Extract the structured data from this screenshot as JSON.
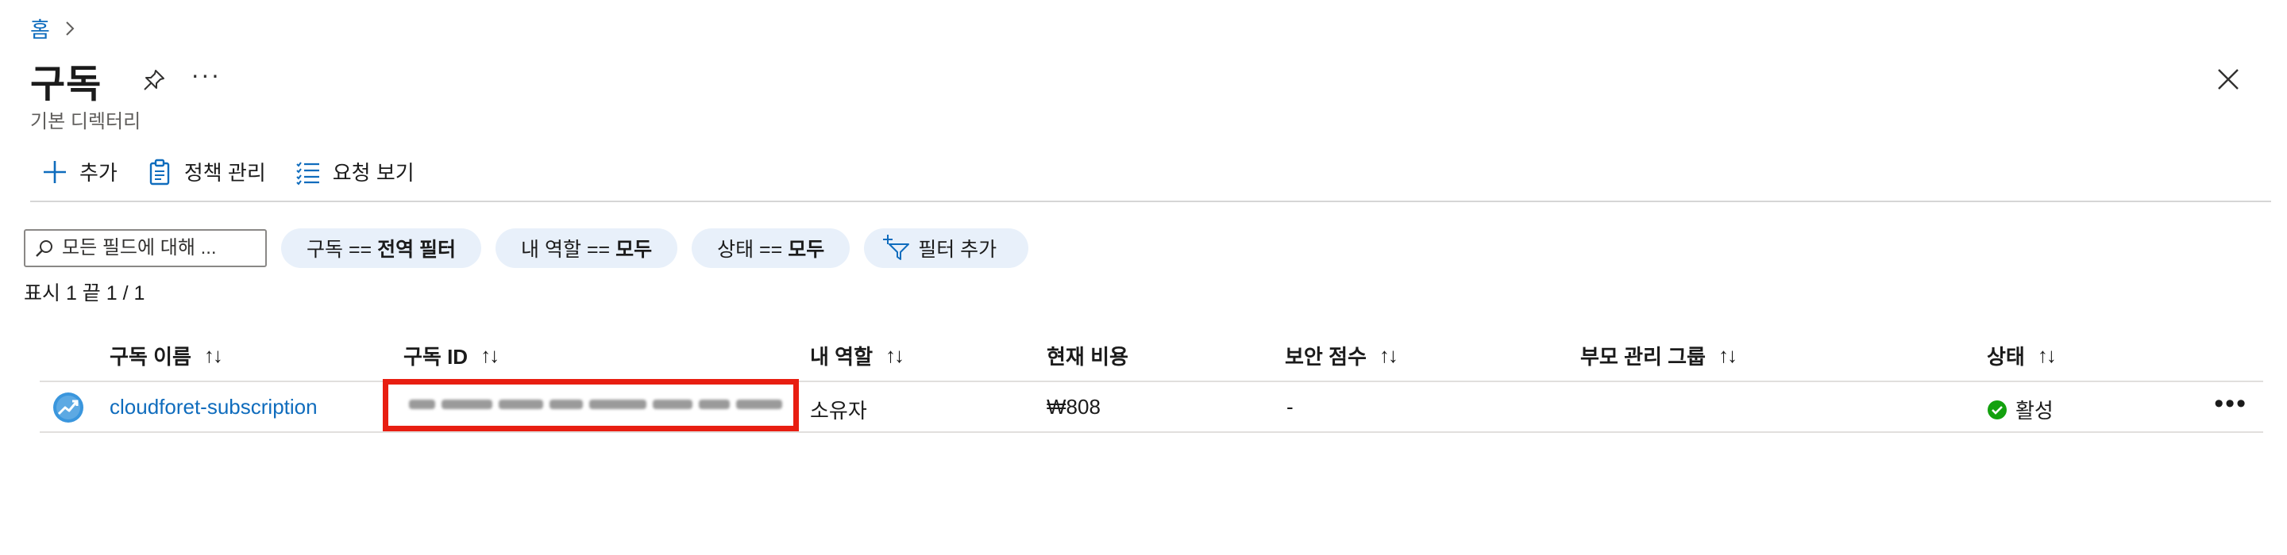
{
  "breadcrumb": {
    "home": "홈"
  },
  "header": {
    "title": "구독",
    "subtitle": "기본 디렉터리",
    "more": "···"
  },
  "toolbar": {
    "add": "추가",
    "policy": "정책 관리",
    "requests": "요청 보기"
  },
  "filters": {
    "search_placeholder": "모든 필드에 대해 ...",
    "pills": [
      {
        "key": "구독 == ",
        "value": "전역 필터"
      },
      {
        "key": "내 역할 == ",
        "value": "모두"
      },
      {
        "key": "상태 == ",
        "value": "모두"
      }
    ],
    "add_filter": "필터 추가"
  },
  "count_text": "표시 1 끝 1 / 1",
  "table": {
    "columns": [
      "구독 이름",
      "구독 ID",
      "내 역할",
      "현재 비용",
      "보안 점수",
      "부모 관리 그룹",
      "상태"
    ],
    "sort_glyph": "↑↓",
    "rows": [
      {
        "name": "cloudforet-subscription",
        "id": "",
        "role": "소유자",
        "cost": "₩808",
        "secure_score": "-",
        "parent_group": "",
        "status": "활성",
        "more": "•••"
      }
    ]
  },
  "colors": {
    "link": "#0f6cbd",
    "highlight": "#e81e11",
    "pill_bg": "#e8f0fa",
    "active": "#13a10e"
  }
}
